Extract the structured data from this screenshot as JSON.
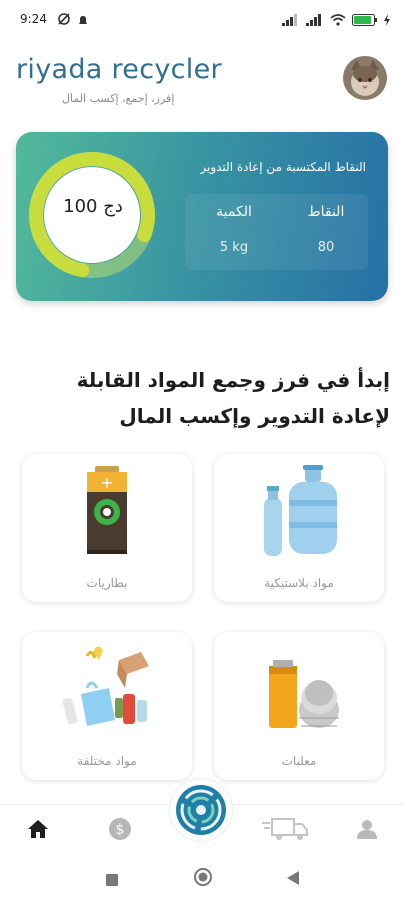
{
  "status": {
    "time": "9:24",
    "battery": "80"
  },
  "header": {
    "app_title": "riyada recycler",
    "tagline": "إفرز، إجمع، إكسب المال"
  },
  "points_card": {
    "title": "النقاط المكتسبة من إعادة التدوير",
    "ring_value": "100 دج",
    "ring_fraction": 0.78,
    "quantity_label": "الكمية",
    "quantity_value": "5 kg",
    "points_label": "النقاط",
    "points_value": "80"
  },
  "headline": "إبدأ في فرز وجمع المواد القابلة لإعادة التدوير وإكسب المال",
  "categories": [
    {
      "label": "مواد بلاستيكية",
      "icon": "plastic-bottles-icon"
    },
    {
      "label": "بطاريات",
      "icon": "battery-icon"
    },
    {
      "label": "معلبات",
      "icon": "cans-icon"
    },
    {
      "label": "مواد مختلفة",
      "icon": "mixed-waste-icon"
    }
  ],
  "nav": {
    "items": [
      "home-icon",
      "dollar-icon",
      "recycle-center-icon",
      "delivery-truck-icon",
      "profile-icon"
    ]
  },
  "colors": {
    "brand": "#2f6f8f",
    "card_start": "#52b99a",
    "card_end": "#2670a6",
    "ring": "#c9dc3e"
  }
}
